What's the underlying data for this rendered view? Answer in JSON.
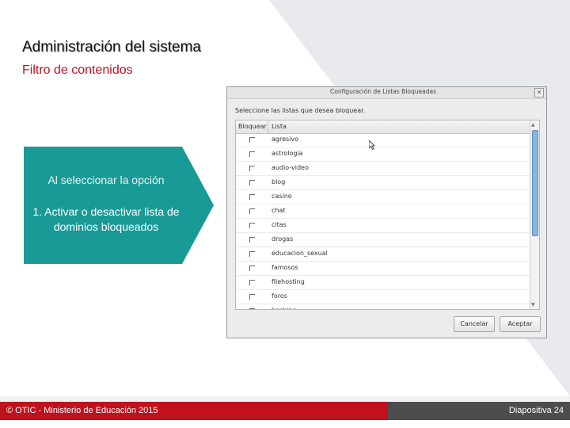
{
  "slide": {
    "title": "Administración del sistema",
    "subtitle": "Filtro de contenidos"
  },
  "callout": {
    "line1": "Al seleccionar la opción",
    "line2": "1. Activar o desactivar lista de dominios bloqueados",
    "color": "#1a9a96"
  },
  "dialog": {
    "title": "Configuración de Listas Bloqueadas",
    "instruction": "Seleccione las listas que desea bloquear.",
    "columns": [
      "Bloquear",
      "Lista"
    ],
    "rows": [
      {
        "name": "agresivo",
        "checked": false
      },
      {
        "name": "astrologia",
        "checked": false
      },
      {
        "name": "audio-video",
        "checked": false
      },
      {
        "name": "blog",
        "checked": false
      },
      {
        "name": "casino",
        "checked": false
      },
      {
        "name": "chat",
        "checked": false
      },
      {
        "name": "citas",
        "checked": false
      },
      {
        "name": "drogas",
        "checked": false
      },
      {
        "name": "educacion_sexual",
        "checked": false
      },
      {
        "name": "famosos",
        "checked": false
      },
      {
        "name": "filehosting",
        "checked": false
      },
      {
        "name": "foros",
        "checked": false
      },
      {
        "name": "hacking",
        "checked": false
      }
    ],
    "cancel_label": "Cancelar",
    "accept_label": "Aceptar",
    "close_glyph": "✕"
  },
  "footer": {
    "left_text": "© OTIC - Ministerio de Educación 2015",
    "right_text": "Diapositiva 24",
    "left_color": "#c0111f",
    "right_color": "#4d4d4d"
  },
  "icons": [
    "close-icon",
    "checkbox-icon",
    "mouse-cursor-icon",
    "scroll-up-icon",
    "scroll-down-icon"
  ]
}
